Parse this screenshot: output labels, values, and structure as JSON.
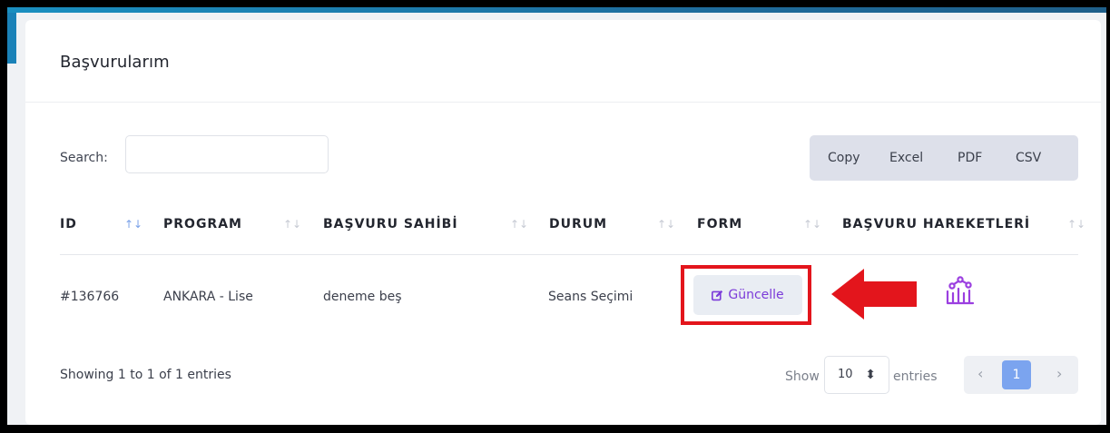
{
  "card": {
    "title": "Başvurularım"
  },
  "search": {
    "label": "Search:",
    "value": "",
    "placeholder": ""
  },
  "export_buttons": [
    "Copy",
    "Excel",
    "PDF",
    "CSV"
  ],
  "table": {
    "columns": [
      "ID",
      "PROGRAM",
      "BAŞVURU SAHİBİ",
      "DURUM",
      "FORM",
      "BAŞVURU HAREKETLERİ"
    ],
    "sort_icon": "↑↓",
    "rows": [
      {
        "id": "#136766",
        "program": "ANKARA - Lise",
        "applicant": "deneme beş",
        "status": "Seans Seçimi",
        "form_button": "Güncelle",
        "history_icon": "chart-people-icon"
      }
    ]
  },
  "footer": {
    "info": "Showing 1 to 1 of 1 entries",
    "show_label": "Show",
    "page_length": "10",
    "entries_label": "entries",
    "prev": "‹",
    "current_page": "1",
    "next": "›"
  },
  "colors": {
    "accent": "#7b3bd9",
    "pager_active": "#7ba4ef",
    "annotation_red": "#e3151c",
    "topbar": "#1a8fc0"
  }
}
